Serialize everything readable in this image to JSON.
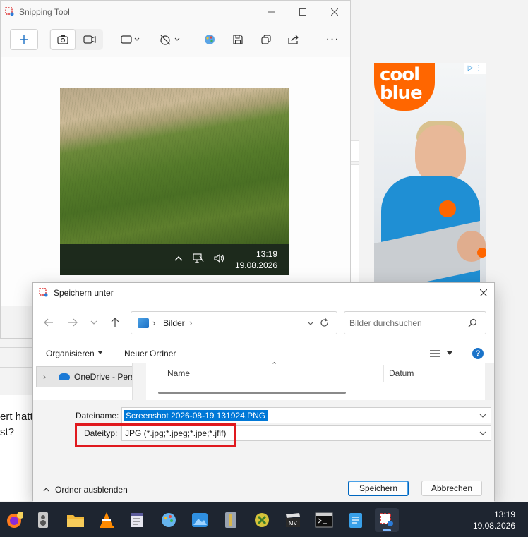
{
  "background": {
    "text_line1": "ert hatt",
    "text_line2": "st?"
  },
  "ad": {
    "brand_line1": "cool",
    "brand_line2": "blue",
    "adchoices": "▷ ⋮",
    "brand_color": "#ff6600"
  },
  "snipping_tool": {
    "title": "Snipping Tool",
    "toolbar": {
      "new_icon": "plus-icon",
      "photo_mode_icon": "camera-icon",
      "video_mode_icon": "video-camera-icon",
      "shape_icon": "rectangle-mode-icon",
      "delay_icon": "timer-off-icon",
      "edit_icon": "paint-icon",
      "save_icon": "save-icon",
      "copy_icon": "copy-icon",
      "share_icon": "share-icon",
      "more_label": "···"
    },
    "capture": {
      "time": "13:19",
      "date": "19.08.2026"
    }
  },
  "dialog": {
    "title": "Speichern unter",
    "address": "Bilder",
    "search_placeholder": "Bilder durchsuchen",
    "organize_label": "Organisieren",
    "new_folder_label": "Neuer Ordner",
    "help_label": "?",
    "nav_item": "OneDrive - Persönlich",
    "columns": {
      "name": "Name",
      "date": "Datum"
    },
    "filename_label": "Dateiname:",
    "filename_value": "Screenshot 2026-08-19 131924.PNG",
    "filetype_label": "Dateityp:",
    "filetype_value": "JPG (*.jpg;*.jpeg;*.jpe;*.jfif)",
    "hide_folders_label": "Ordner ausblenden",
    "save_label": "Speichern",
    "cancel_label": "Abbrechen",
    "highlight_color": "#e0191e"
  },
  "taskbar": {
    "apps": [
      "firefox",
      "speaker-app",
      "file-explorer",
      "vlc",
      "notepad-plus",
      "paint",
      "photos",
      "archive",
      "maps",
      "movie-maker",
      "terminal",
      "notepad",
      "snipping-tool"
    ],
    "time": "13:19",
    "date": "19.08.2026"
  }
}
